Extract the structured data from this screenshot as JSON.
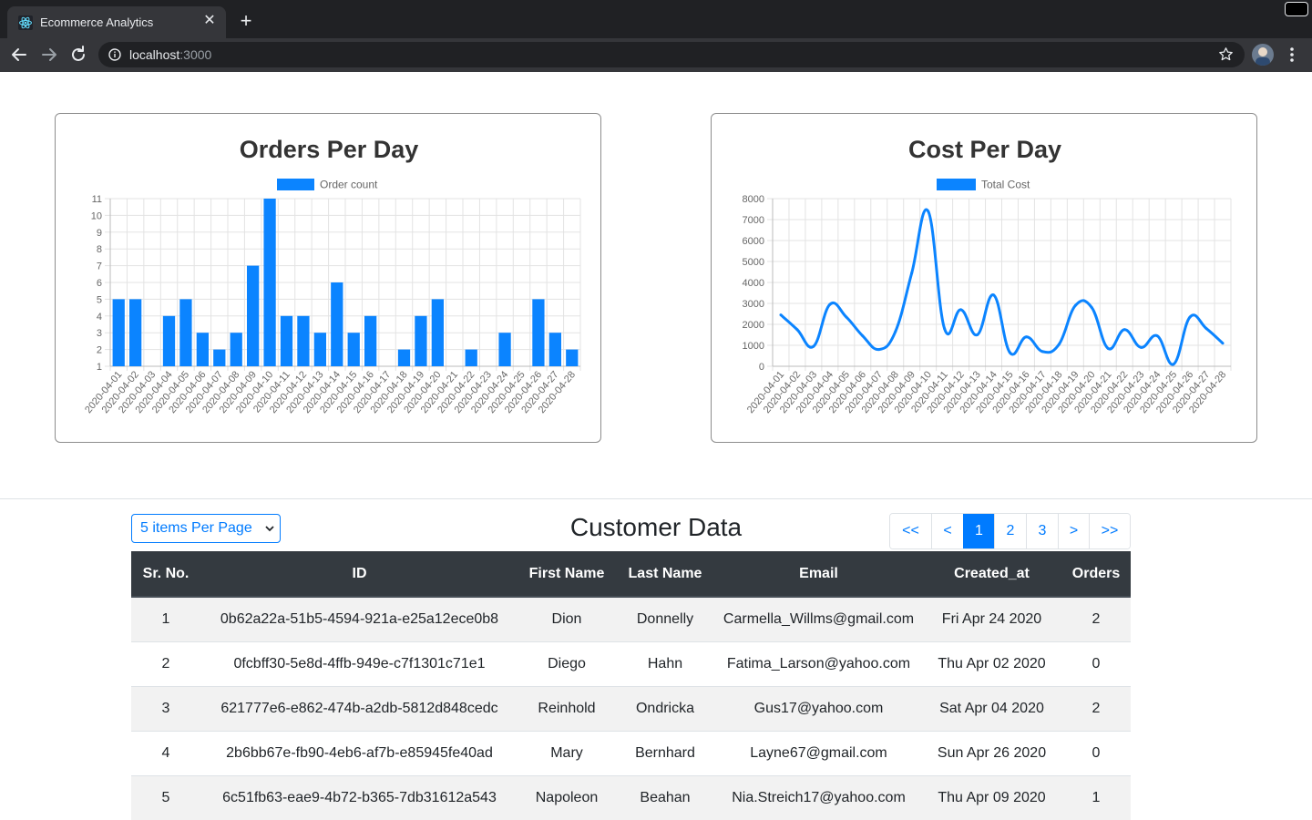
{
  "browser": {
    "tab_title": "Ecommerce Analytics",
    "url_host": "localhost",
    "url_port": ":3000",
    "new_tab_label": "+",
    "close_label": "✕"
  },
  "charts": {
    "orders": {
      "title": "Orders Per Day",
      "legend": "Order count"
    },
    "cost": {
      "title": "Cost Per Day",
      "legend": "Total Cost"
    }
  },
  "chart_data": [
    {
      "type": "bar",
      "title": "Orders Per Day",
      "series": [
        {
          "name": "Order count",
          "values": [
            5,
            5,
            0,
            4,
            5,
            3,
            2,
            3,
            7,
            11,
            4,
            4,
            3,
            6,
            3,
            4,
            0,
            2,
            4,
            5,
            0,
            2,
            0,
            3,
            0,
            5,
            3,
            2
          ]
        }
      ],
      "categories": [
        "2020-04-01",
        "2020-04-02",
        "2020-04-03",
        "2020-04-04",
        "2020-04-05",
        "2020-04-06",
        "2020-04-07",
        "2020-04-08",
        "2020-04-09",
        "2020-04-10",
        "2020-04-11",
        "2020-04-12",
        "2020-04-13",
        "2020-04-14",
        "2020-04-15",
        "2020-04-16",
        "2020-04-17",
        "2020-04-18",
        "2020-04-19",
        "2020-04-20",
        "2020-04-21",
        "2020-04-22",
        "2020-04-23",
        "2020-04-24",
        "2020-04-25",
        "2020-04-26",
        "2020-04-27",
        "2020-04-28"
      ],
      "ylim": [
        1,
        11
      ],
      "yticks": [
        1,
        2,
        3,
        4,
        5,
        6,
        7,
        8,
        9,
        10,
        11
      ],
      "grid": true,
      "legend_position": "top",
      "color": "#0b84ff"
    },
    {
      "type": "line",
      "title": "Cost Per Day",
      "series": [
        {
          "name": "Total Cost",
          "values": [
            2450,
            1750,
            950,
            2950,
            2350,
            1450,
            800,
            1650,
            4450,
            7400,
            1800,
            2700,
            1500,
            3400,
            650,
            1400,
            700,
            1050,
            2900,
            2800,
            850,
            1750,
            900,
            1450,
            100,
            2350,
            1800,
            1100
          ]
        }
      ],
      "categories": [
        "2020-04-01",
        "2020-04-02",
        "2020-04-03",
        "2020-04-04",
        "2020-04-05",
        "2020-04-06",
        "2020-04-07",
        "2020-04-08",
        "2020-04-09",
        "2020-04-10",
        "2020-04-11",
        "2020-04-12",
        "2020-04-13",
        "2020-04-14",
        "2020-04-15",
        "2020-04-16",
        "2020-04-17",
        "2020-04-18",
        "2020-04-19",
        "2020-04-20",
        "2020-04-21",
        "2020-04-22",
        "2020-04-23",
        "2020-04-24",
        "2020-04-25",
        "2020-04-26",
        "2020-04-27",
        "2020-04-28"
      ],
      "ylim": [
        0,
        8000
      ],
      "yticks": [
        0,
        1000,
        2000,
        3000,
        4000,
        5000,
        6000,
        7000,
        8000
      ],
      "grid": true,
      "legend_position": "top",
      "color": "#0b84ff"
    }
  ],
  "customer": {
    "title": "Customer Data",
    "per_page": "5 items Per Page",
    "pager": [
      {
        "label": "<<",
        "active": false
      },
      {
        "label": "<",
        "active": false
      },
      {
        "label": "1",
        "active": true
      },
      {
        "label": "2",
        "active": false
      },
      {
        "label": "3",
        "active": false
      },
      {
        "label": ">",
        "active": false
      },
      {
        "label": ">>",
        "active": false
      }
    ],
    "columns": [
      "Sr. No.",
      "ID",
      "First Name",
      "Last Name",
      "Email",
      "Created_at",
      "Orders"
    ],
    "rows": [
      [
        "1",
        "0b62a22a-51b5-4594-921a-e25a12ece0b8",
        "Dion",
        "Donnelly",
        "Carmella_Willms@gmail.com",
        "Fri Apr 24 2020",
        "2"
      ],
      [
        "2",
        "0fcbff30-5e8d-4ffb-949e-c7f1301c71e1",
        "Diego",
        "Hahn",
        "Fatima_Larson@yahoo.com",
        "Thu Apr 02 2020",
        "0"
      ],
      [
        "3",
        "621777e6-e862-474b-a2db-5812d848cedc",
        "Reinhold",
        "Ondricka",
        "Gus17@yahoo.com",
        "Sat Apr 04 2020",
        "2"
      ],
      [
        "4",
        "2b6bb67e-fb90-4eb6-af7b-e85945fe40ad",
        "Mary",
        "Bernhard",
        "Layne67@gmail.com",
        "Sun Apr 26 2020",
        "0"
      ],
      [
        "5",
        "6c51fb63-eae9-4b72-b365-7db31612a543",
        "Napoleon",
        "Beahan",
        "Nia.Streich17@yahoo.com",
        "Thu Apr 09 2020",
        "1"
      ]
    ]
  }
}
